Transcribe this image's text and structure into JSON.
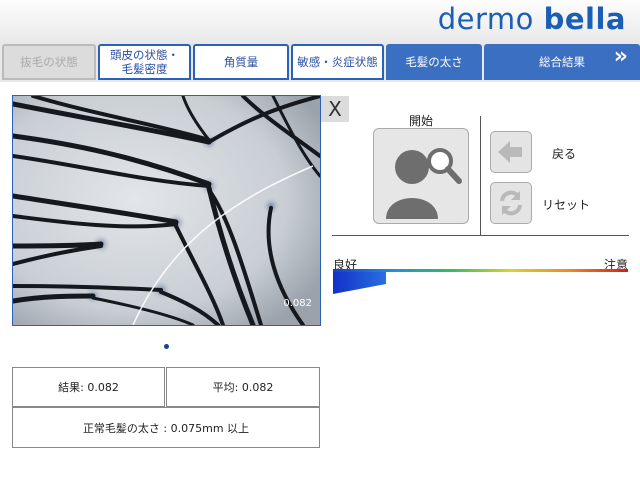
{
  "brand": {
    "part1": "dermo ",
    "part2": "bella",
    "color": "#1a5fb4"
  },
  "tabs": [
    {
      "label": "抜毛の状態",
      "state": "disabled"
    },
    {
      "label": "頭皮の状態・毛髪密度",
      "state": "normal"
    },
    {
      "label": "角質量",
      "state": "normal"
    },
    {
      "label": "敏感・炎症状態",
      "state": "normal"
    },
    {
      "label": "毛髪の太さ",
      "state": "active"
    },
    {
      "label": "総合結果",
      "state": "result"
    }
  ],
  "tab_lines": {
    "t1a": "頭皮の状態・",
    "t1b": "毛髪密度"
  },
  "image": {
    "overlay_value": "0.082",
    "close_label": "X"
  },
  "controls": {
    "start_label": "開始",
    "back_label": "戻る",
    "reset_label": "リセット"
  },
  "scale": {
    "good_label": "良好",
    "bad_label": "注意",
    "level_fraction": 0.18
  },
  "results": {
    "result_text": "結果: 0.082",
    "average_text": "平均: 0.082",
    "normal_text": "正常毛髪の太さ : 0.075mm 以上"
  },
  "colors": {
    "accent": "#3b6fc2",
    "border": "#2a62b8"
  },
  "icons": {
    "next": "double-chevron-right-icon",
    "start": "person-search-icon",
    "back": "arrow-left-icon",
    "reset": "refresh-icon"
  }
}
